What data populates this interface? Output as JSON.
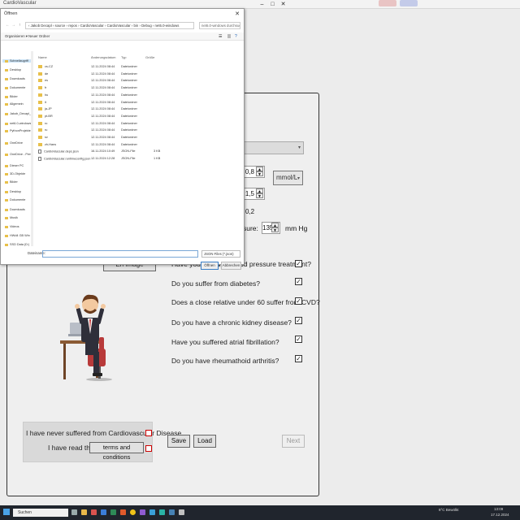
{
  "app": {
    "title": "CardioVascular",
    "window_controls": [
      "–",
      "□",
      "✕"
    ]
  },
  "form": {
    "unit_dropdown": "mmol/L",
    "top_dropdown_partial": "uit",
    "spinner1_value": "0,8",
    "spinner2_value": "1,5",
    "partial_text": "0,2",
    "pressure_label_partial": "essure:",
    "pressure_value": "135",
    "pressure_unit": "mm Hg",
    "left_button_partial": "Erl Image",
    "questions": [
      {
        "text": "Have you received blood pressure treatment?",
        "checked": true
      },
      {
        "text": "Do you suffer from diabetes?",
        "checked": true
      },
      {
        "text": "Does a close relative under 60 suffer from CVD?",
        "checked": true
      },
      {
        "text": "Do you have a chronic kidney disease?",
        "checked": true
      },
      {
        "text": "Have you suffered atrial fibrillation?",
        "checked": true
      },
      {
        "text": "Do you have rheumathoid arthritis?",
        "checked": true
      }
    ],
    "consent_line1": "I have never suffered from Cardiovascular Disease",
    "consent_line2_prefix": "I have read the",
    "terms_button": "terms and conditions",
    "save_button": "Save",
    "load_button": "Load",
    "next_button": "Next"
  },
  "dialog": {
    "title": "Öffnen",
    "close": "✕",
    "address": "‹ Jakob Decapl › source › repos › CardioVascular › CardioVascular › bin › Debug › net6.0-windows",
    "search_placeholder": "net6.0-windows durchsuchen",
    "toolbar_organize": "Organisieren ▾",
    "toolbar_new_folder": "Neuer Ordner",
    "nav_items": [
      "Schnellzugriff",
      "Desktop",
      "Downloads",
      "Dokumente",
      "Bilder",
      "Allgemein",
      "Jakob_Decapl_E",
      "net6.0-windows",
      "PythonProjekte",
      "OneDrive",
      "OneDrive - Person",
      "Dieser PC",
      "3D-Objekte",
      "Bilder",
      "Desktop",
      "Dokumente",
      "Downloads",
      "Musik",
      "Videos",
      "HWd4 GB Win",
      "SSD Data (D:)"
    ],
    "columns": [
      "Name",
      "Änderungsdatum",
      "Typ",
      "Größe"
    ],
    "files": [
      {
        "name": "cs-CZ",
        "date": "12.11.2024 08:44",
        "type": "Dateiordner",
        "size": "",
        "folder": true
      },
      {
        "name": "de",
        "date": "12.11.2024 08:44",
        "type": "Dateiordner",
        "size": "",
        "folder": true
      },
      {
        "name": "es",
        "date": "12.11.2024 08:44",
        "type": "Dateiordner",
        "size": "",
        "folder": true
      },
      {
        "name": "fr",
        "date": "12.11.2024 08:44",
        "type": "Dateiordner",
        "size": "",
        "folder": true
      },
      {
        "name": "hu",
        "date": "12.11.2024 08:44",
        "type": "Dateiordner",
        "size": "",
        "folder": true
      },
      {
        "name": "it",
        "date": "12.11.2024 08:44",
        "type": "Dateiordner",
        "size": "",
        "folder": true
      },
      {
        "name": "ja-JP",
        "date": "12.11.2024 08:44",
        "type": "Dateiordner",
        "size": "",
        "folder": true
      },
      {
        "name": "pt-BR",
        "date": "12.11.2024 08:44",
        "type": "Dateiordner",
        "size": "",
        "folder": true
      },
      {
        "name": "ro",
        "date": "12.11.2024 08:44",
        "type": "Dateiordner",
        "size": "",
        "folder": true
      },
      {
        "name": "ru",
        "date": "12.11.2024 08:44",
        "type": "Dateiordner",
        "size": "",
        "folder": true
      },
      {
        "name": "sv",
        "date": "12.11.2024 08:44",
        "type": "Dateiordner",
        "size": "",
        "folder": true
      },
      {
        "name": "zh-Hans",
        "date": "12.11.2024 08:44",
        "type": "Dateiordner",
        "size": "",
        "folder": true
      },
      {
        "name": "CardioVascular.deps.json",
        "date": "16.11.2024 10:49",
        "type": "JSON-File",
        "size": "3 KB",
        "folder": false
      },
      {
        "name": "CardioVascular.runtimeconfig.json",
        "date": "12.11.2024 12:28",
        "type": "JSON-File",
        "size": "1 KB",
        "folder": false
      }
    ],
    "filename_label": "Dateiname:",
    "filetype": "JSON Files (*.json)",
    "open_button": "Öffnen",
    "cancel_button": "Abbrechen"
  },
  "taskbar": {
    "search": "Suchen",
    "weather": "8°C Bewölkt",
    "time": "13:09",
    "date": "17.12.2024"
  }
}
